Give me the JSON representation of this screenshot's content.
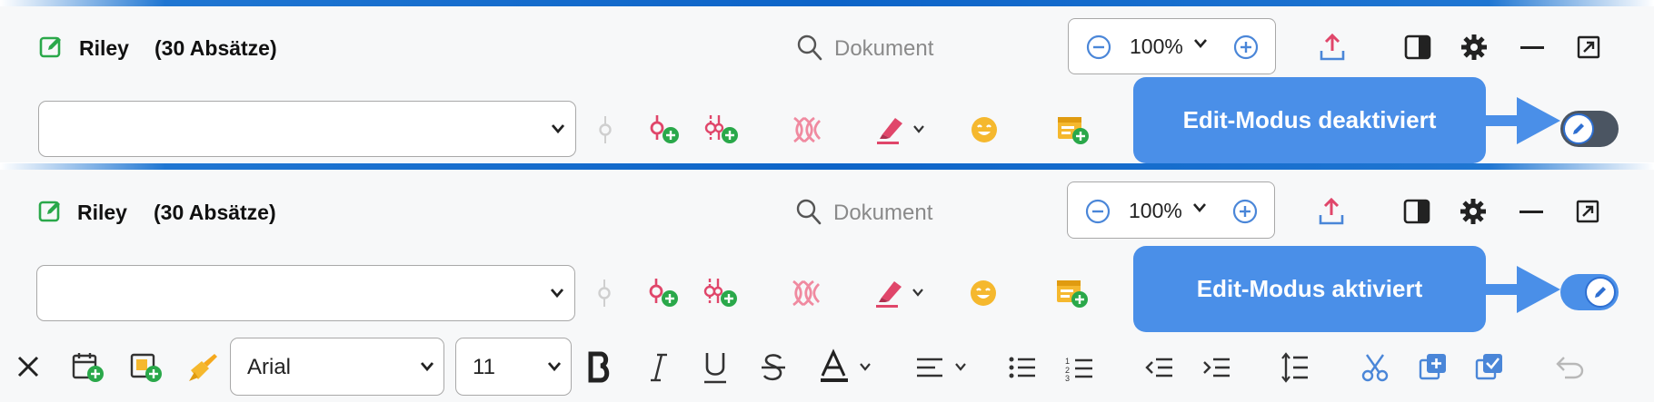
{
  "panel_off": {
    "doc_title": "Riley",
    "paragraph_count": "(30 Absätze)",
    "search_placeholder": "Dokument",
    "zoom": "100%",
    "callout": "Edit-Modus deaktiviert",
    "edit_mode_on": false
  },
  "panel_on": {
    "doc_title": "Riley",
    "paragraph_count": "(30 Absätze)",
    "search_placeholder": "Dokument",
    "zoom": "100%",
    "callout": "Edit-Modus aktiviert",
    "edit_mode_on": true
  },
  "format_toolbar": {
    "font": "Arial",
    "font_size": "11"
  },
  "colors": {
    "accent_blue": "#1f76d2",
    "callout_blue": "#4a8fe8",
    "icon_pink": "#e0466a",
    "icon_green": "#2aa84a",
    "icon_yellow": "#f5b82e",
    "toggle_off": "#4b5562",
    "toggle_on": "#4a8fe8"
  },
  "icons": {
    "header": [
      "edit-note-icon",
      "search-icon",
      "zoom-out-icon",
      "chevron-down-icon",
      "zoom-in-icon",
      "share-upload-icon",
      "split-view-icon",
      "gear-icon",
      "minimize-icon",
      "popout-icon"
    ],
    "toolbar": [
      "node-icon",
      "add-node-icon",
      "add-split-node-icon",
      "dna-icon",
      "highlighter-icon",
      "emoji-icon",
      "add-note-icon",
      "edit-mode-toggle"
    ],
    "format": [
      "close-icon",
      "add-date-icon",
      "add-image-icon",
      "format-painter-icon",
      "bold-icon",
      "italic-icon",
      "underline-icon",
      "strikethrough-icon",
      "text-color-icon",
      "align-icon",
      "bullet-list-icon",
      "numbered-list-icon",
      "outdent-icon",
      "indent-icon",
      "line-spacing-icon",
      "cut-icon",
      "add-copy-icon",
      "checkbox-copy-icon",
      "undo-icon"
    ]
  }
}
